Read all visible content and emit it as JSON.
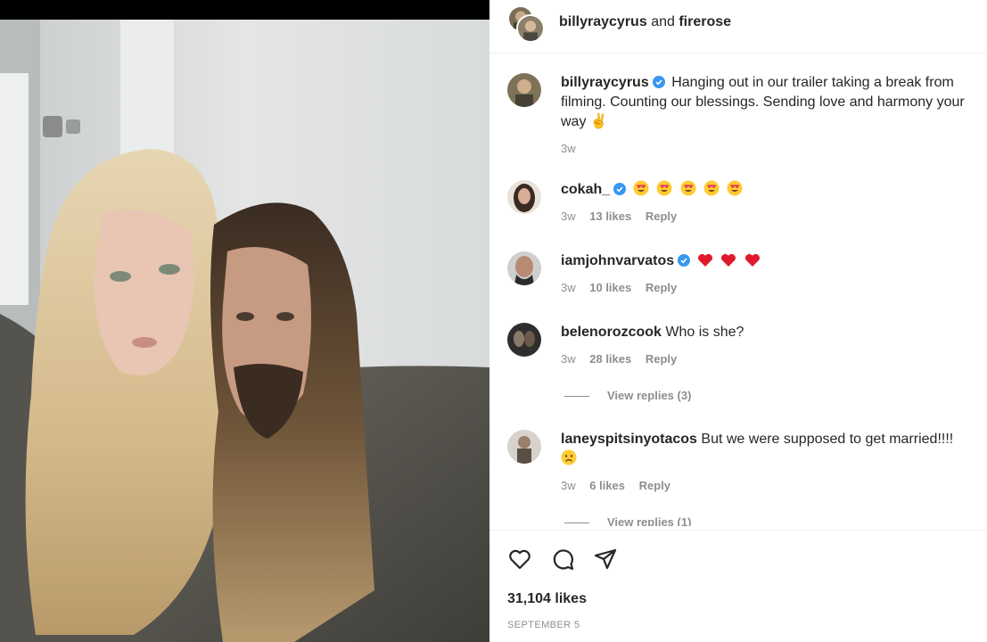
{
  "header": {
    "user1": "billyraycyrus",
    "connector": "and",
    "user2": "firerose"
  },
  "caption": {
    "username": "billyraycyrus",
    "text": "Hanging out in our trailer taking a break from filming. Counting our blessings. Sending love and harmony your way",
    "emoji": "✌️",
    "time": "3w"
  },
  "comments": [
    {
      "username": "cokah_",
      "verified": true,
      "text": "",
      "emoji": [
        "heart-eyes",
        "heart-eyes",
        "heart-eyes",
        "heart-eyes",
        "heart-eyes"
      ],
      "time": "3w",
      "likes": "13 likes",
      "reply": "Reply"
    },
    {
      "username": "iamjohnvarvatos",
      "verified": true,
      "text": "",
      "emoji": [
        "red-heart",
        "red-heart",
        "red-heart"
      ],
      "time": "3w",
      "likes": "10 likes",
      "reply": "Reply"
    },
    {
      "username": "belenorozcook",
      "verified": false,
      "text": "Who is she?",
      "time": "3w",
      "likes": "28 likes",
      "reply": "Reply",
      "view_replies": "View replies (3)"
    },
    {
      "username": "laneyspitsinyotacos",
      "verified": false,
      "text": "But we were supposed to get married!!!!",
      "emoji": [
        "frowning-face"
      ],
      "time": "3w",
      "likes": "6 likes",
      "reply": "Reply",
      "view_replies": "View replies (1)"
    }
  ],
  "actions": {
    "icons": [
      "heart-icon",
      "comment-icon",
      "share-icon"
    ]
  },
  "likes_total": "31,104 likes",
  "date": "SEPTEMBER 5",
  "colors": {
    "verified": "#3897f0",
    "muted": "#8e8e8e",
    "text": "#262626"
  }
}
